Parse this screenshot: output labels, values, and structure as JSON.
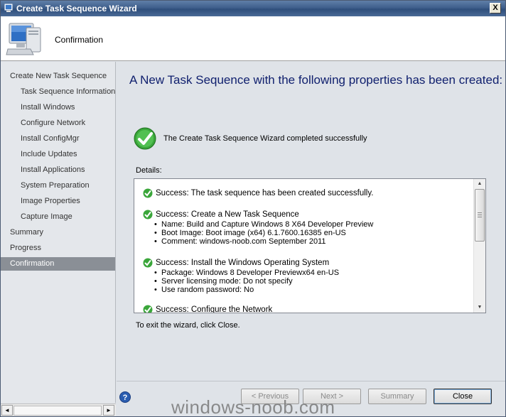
{
  "window": {
    "title": "Create Task Sequence Wizard",
    "close_label": "X"
  },
  "header": {
    "title": "Confirmation"
  },
  "sidebar": {
    "items": [
      {
        "label": "Create New Task Sequence",
        "level": "top",
        "active": false
      },
      {
        "label": "Task Sequence Information",
        "level": "sub",
        "active": false
      },
      {
        "label": "Install Windows",
        "level": "sub",
        "active": false
      },
      {
        "label": "Configure Network",
        "level": "sub",
        "active": false
      },
      {
        "label": "Install ConfigMgr",
        "level": "sub",
        "active": false
      },
      {
        "label": "Include Updates",
        "level": "sub",
        "active": false
      },
      {
        "label": "Install Applications",
        "level": "sub",
        "active": false
      },
      {
        "label": "System Preparation",
        "level": "sub",
        "active": false
      },
      {
        "label": "Image Properties",
        "level": "sub",
        "active": false
      },
      {
        "label": "Capture Image",
        "level": "sub",
        "active": false
      },
      {
        "label": "Summary",
        "level": "top",
        "active": false
      },
      {
        "label": "Progress",
        "level": "top",
        "active": false
      },
      {
        "label": "Confirmation",
        "level": "top",
        "active": true
      }
    ]
  },
  "main": {
    "heading": "A New Task Sequence with the following properties has been created:",
    "success_message": "The Create Task Sequence Wizard completed successfully",
    "details_label": "Details:",
    "details": [
      {
        "head": "Success: The task sequence has been created successfully.",
        "lines": []
      },
      {
        "head": "Success: Create a New Task Sequence",
        "lines": [
          "Name: Build and Capture Windows 8 X64 Developer Preview",
          "Boot Image: Boot image (x64) 6.1.7600.16385 en-US",
          "Comment: windows-noob.com September 2011"
        ]
      },
      {
        "head": "Success: Install the Windows Operating System",
        "lines": [
          "Package: Windows 8 Developer Previewx64  en-US",
          "Server licensing mode: Do not specify",
          "Use random password: No"
        ]
      },
      {
        "head": "Success: Configure the Network",
        "lines": []
      }
    ],
    "exit_text": "To exit the wizard, click Close."
  },
  "footer": {
    "help_label": "?",
    "previous_label": "< Previous",
    "next_label": "Next >",
    "summary_label": "Summary",
    "close_label": "Close"
  },
  "hscroll": {
    "left_arrow": "◄",
    "right_arrow": "►"
  },
  "vscroll": {
    "up_arrow": "▲",
    "down_arrow": "▼"
  },
  "watermark": "windows-noob.com",
  "colors": {
    "heading": "#10206e",
    "active_nav_bg": "#8a8f96",
    "check_green": "#3aa63a"
  },
  "icons": {
    "title": "wizard-computer-icon",
    "header": "computer-monitor-icon",
    "success": "green-checkmark-icon",
    "help": "help-icon"
  }
}
